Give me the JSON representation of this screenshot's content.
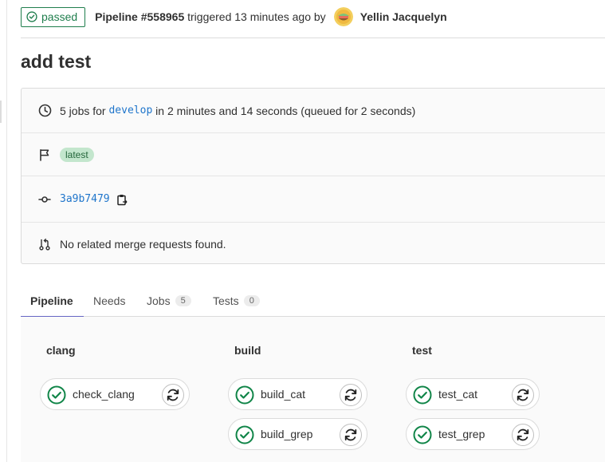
{
  "header": {
    "status": "passed",
    "pipeline_id": "Pipeline #558965",
    "triggered_text": "triggered 13 minutes ago by",
    "author": "Yellin Jacquelyn"
  },
  "title": "add test",
  "info": {
    "jobs_prefix": "5 jobs for",
    "branch": "develop",
    "duration_text": "in 2 minutes and 14 seconds (queued for 2 seconds)",
    "tag": "latest",
    "commit": "3a9b7479",
    "merge_requests": "No related merge requests found."
  },
  "tabs": [
    {
      "label": "Pipeline"
    },
    {
      "label": "Needs"
    },
    {
      "label": "Jobs",
      "count": "5"
    },
    {
      "label": "Tests",
      "count": "0"
    }
  ],
  "stages": [
    {
      "name": "clang",
      "jobs": [
        "check_clang"
      ]
    },
    {
      "name": "build",
      "jobs": [
        "build_cat",
        "build_grep"
      ]
    },
    {
      "name": "test",
      "jobs": [
        "test_cat",
        "test_grep"
      ]
    }
  ],
  "colors": {
    "success": "#1f7e4d",
    "success_icon": "#108548",
    "link": "#1f75cb",
    "active_tab": "#6666c4",
    "badge_bg": "#c3e6cd"
  },
  "icons": {
    "status": "check-circle-icon",
    "duration": "clock-icon",
    "tags": "flag-icon",
    "commit": "commit-icon",
    "copy": "clipboard-icon",
    "merge_requests": "merge-request-icon",
    "retry": "retry-icon"
  }
}
